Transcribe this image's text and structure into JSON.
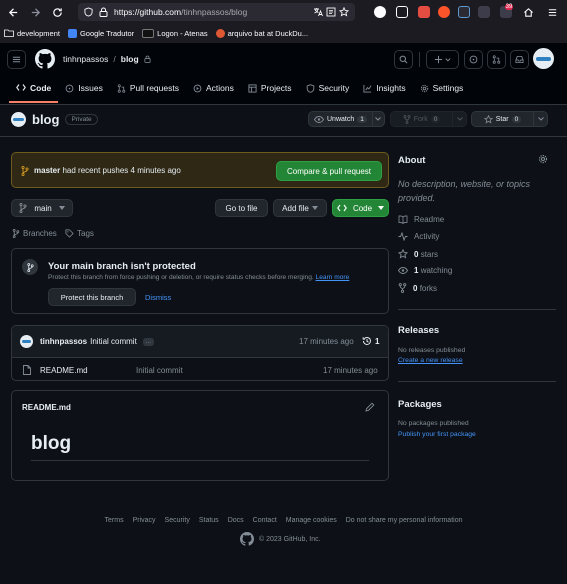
{
  "browser": {
    "url_host": "https://github.com",
    "url_path": "/tinhnpassos/blog",
    "bookmarks": [
      {
        "label": "development"
      },
      {
        "label": "Google Tradutor"
      },
      {
        "label": "Logon - Atenas"
      },
      {
        "label": "arquivo bat at DuckDu..."
      }
    ],
    "ext_badge": "39"
  },
  "header": {
    "owner": "tinhnpassos",
    "sep": "/",
    "repo": "blog"
  },
  "repo_nav": [
    {
      "label": "Code",
      "icon": "code-icon"
    },
    {
      "label": "Issues",
      "icon": "issue-icon"
    },
    {
      "label": "Pull requests",
      "icon": "pull-request-icon"
    },
    {
      "label": "Actions",
      "icon": "play-icon"
    },
    {
      "label": "Projects",
      "icon": "table-icon"
    },
    {
      "label": "Security",
      "icon": "shield-icon"
    },
    {
      "label": "Insights",
      "icon": "graph-icon"
    },
    {
      "label": "Settings",
      "icon": "gear-icon"
    }
  ],
  "repo": {
    "name": "blog",
    "visibility": "Private",
    "unwatch_label": "Unwatch",
    "unwatch_count": "1",
    "fork_label": "Fork",
    "fork_count": "0",
    "star_label": "Star",
    "star_count": "0"
  },
  "banner": {
    "branch": "master",
    "message": "had recent pushes 4 minutes ago",
    "button": "Compare & pull request"
  },
  "toolbar": {
    "branch": "main",
    "go_to_file": "Go to file",
    "add_file": "Add file",
    "code": "Code",
    "branches": "Branches",
    "tags": "Tags"
  },
  "protect": {
    "title": "Your main branch isn't protected",
    "desc": "Protect this branch from force pushing or deletion, or require status checks before merging.",
    "learn_more": "Learn more",
    "protect_button": "Protect this branch",
    "dismiss": "Dismiss"
  },
  "commit": {
    "author": "tinhnpassos",
    "message": "Initial commit",
    "ellipsis": "...",
    "time": "17 minutes ago",
    "count": "1"
  },
  "files": [
    {
      "name": "README.md",
      "message": "Initial commit",
      "time": "17 minutes ago"
    }
  ],
  "readme": {
    "title": "README.md",
    "heading": "blog"
  },
  "about": {
    "title": "About",
    "description": "No description, website, or topics provided.",
    "items": [
      {
        "label": "Readme",
        "icon": "book-icon"
      },
      {
        "label": "Activity",
        "icon": "pulse-icon"
      },
      {
        "count": "0",
        "label": "stars",
        "icon": "star-icon"
      },
      {
        "count": "1",
        "label": "watching",
        "icon": "eye-icon"
      },
      {
        "count": "0",
        "label": "forks",
        "icon": "fork-icon"
      }
    ]
  },
  "releases": {
    "title": "Releases",
    "empty": "No releases published",
    "link": "Create a new release"
  },
  "packages": {
    "title": "Packages",
    "empty": "No packages published",
    "link": "Publish your first package"
  },
  "footer": {
    "links": [
      "Terms",
      "Privacy",
      "Security",
      "Status",
      "Docs",
      "Contact",
      "Manage cookies",
      "Do not share my personal information"
    ],
    "copyright": "© 2023 GitHub, Inc."
  },
  "colors": {
    "accent_green": "#238636",
    "link_blue": "#4493f8",
    "nav_underline": "#f78166",
    "banner_bg": "#2f2814"
  }
}
